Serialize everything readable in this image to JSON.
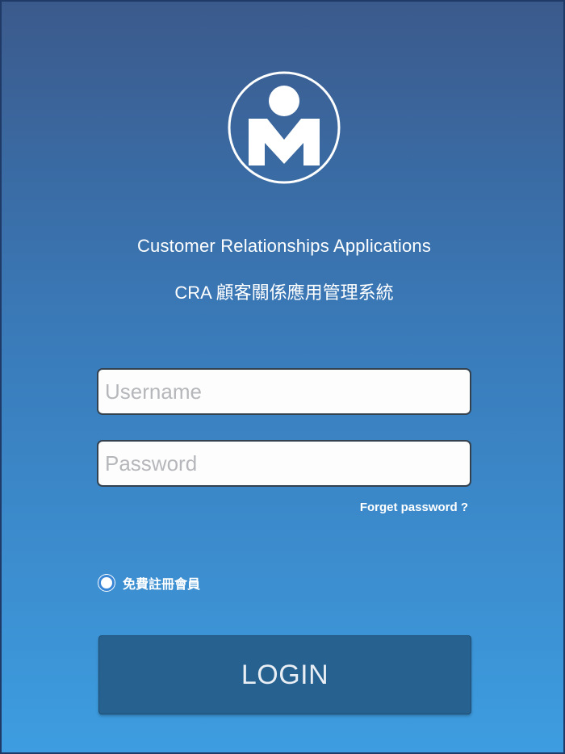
{
  "header": {
    "logo_icon": "circle-m-logo-icon",
    "title": "Customer Relationships Applications",
    "subtitle": "CRA 顧客關係應用管理系統"
  },
  "form": {
    "username_placeholder": "Username",
    "username_value": "",
    "password_placeholder": "Password",
    "password_value": "",
    "forgot_password_label": "Forget password ?",
    "register_label": "免費註冊會員",
    "login_label": "LOGIN"
  },
  "colors": {
    "background_top": "#3b5a8c",
    "background_bottom": "#3d9de0",
    "login_button": "#26618f",
    "text": "#ffffff"
  }
}
